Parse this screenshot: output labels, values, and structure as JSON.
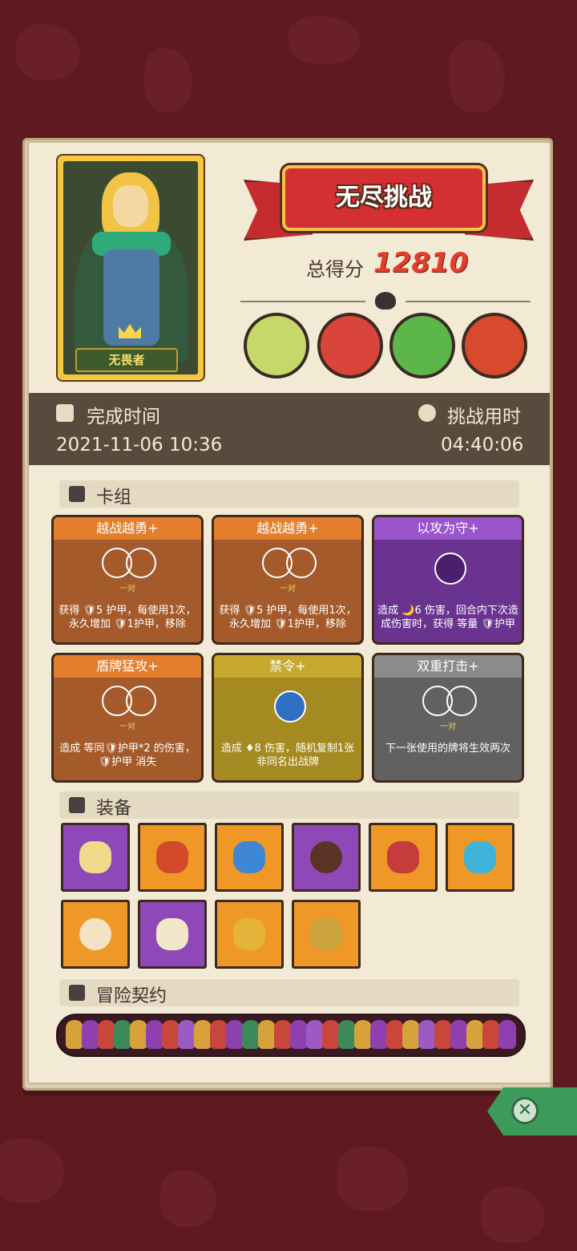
{
  "hero": {
    "name": "无畏者"
  },
  "mode_banner": "无尽挑战",
  "score": {
    "label": "总得分",
    "value": "12810"
  },
  "time": {
    "finish_label": "完成时间",
    "finish_value": "2021-11-06 10:36",
    "duration_label": "挑战用时",
    "duration_value": "04:40:06"
  },
  "deck": {
    "header": "卡组",
    "cards": [
      {
        "title": "越战越勇+",
        "tag": "一对",
        "desc": "获得 🛡5 护甲，每使用1次，永久增加 🛡1护甲，移除",
        "color": "orange",
        "icon": "rings"
      },
      {
        "title": "越战越勇+",
        "tag": "一对",
        "desc": "获得 🛡5 护甲，每使用1次，永久增加 🛡1护甲，移除",
        "color": "orange",
        "icon": "rings"
      },
      {
        "title": "以攻为守+",
        "tag": "",
        "desc": "造成 🌙6 伤害，回合内下次造成伤害时，获得 等量 🛡护甲",
        "color": "purple",
        "icon": "moon"
      },
      {
        "title": "盾牌猛攻+",
        "tag": "一对",
        "desc": "造成 等同🛡护甲*2 的伤害，🛡护甲 消失",
        "color": "orange",
        "icon": "rings"
      },
      {
        "title": "禁令+",
        "tag": "",
        "desc": "造成 ♦8 伤害，随机复制1张非同名出战牌",
        "color": "olive",
        "icon": "drop"
      },
      {
        "title": "双重打击+",
        "tag": "一对",
        "desc": "下一张使用的牌将生效两次",
        "color": "gray",
        "icon": "rings"
      }
    ]
  },
  "equipment": {
    "header": "装备",
    "items": [
      {
        "name": "mirror-icon",
        "color": "purple"
      },
      {
        "name": "meat-icon",
        "color": "orange"
      },
      {
        "name": "mushroom-icon",
        "color": "orange"
      },
      {
        "name": "button-icon",
        "color": "purple"
      },
      {
        "name": "mask-icon",
        "color": "orange"
      },
      {
        "name": "crystal-shield-icon",
        "color": "orange"
      },
      {
        "name": "ring-icon",
        "color": "orange"
      },
      {
        "name": "claws-icon",
        "color": "purple"
      },
      {
        "name": "feather-icon",
        "color": "orange"
      },
      {
        "name": "golden-dice-icon",
        "color": "orange"
      }
    ]
  },
  "contracts": {
    "header": "冒险契约"
  },
  "colors": {
    "accent": "#e23d2e",
    "background": "#5e1a1f",
    "paper": "#f3ead6"
  }
}
